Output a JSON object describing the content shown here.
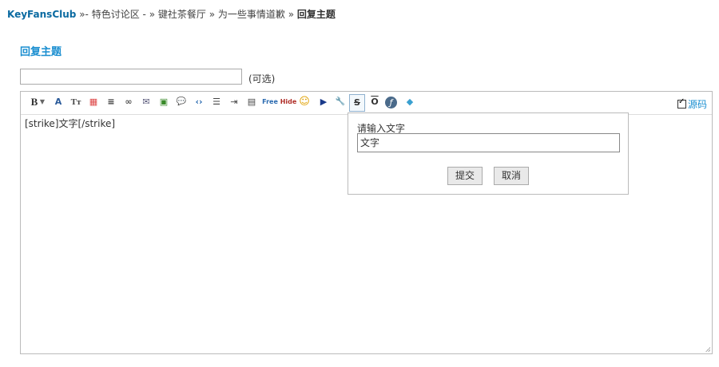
{
  "breadcrumb": {
    "site": "KeyFansClub",
    "sep1": "»-",
    "forum": "特色讨论区 -",
    "sep2": "»",
    "board": "键社茶餐厅",
    "sep3": "»",
    "thread": "为一些事情道歉",
    "sep4": "»",
    "current": "回复主题"
  },
  "page_title": "回复主题",
  "subject": {
    "value": "",
    "optional_label": "(可选)"
  },
  "toolbar": {
    "buttons": [
      {
        "name": "bold-icon",
        "glyph": "B"
      },
      {
        "name": "font-color-icon",
        "glyph": "A"
      },
      {
        "name": "font-size-icon",
        "glyph": "Tт"
      },
      {
        "name": "color-grid-icon",
        "glyph": "▦"
      },
      {
        "name": "align-icon",
        "glyph": "≡"
      },
      {
        "name": "link-icon",
        "glyph": "∞"
      },
      {
        "name": "email-icon",
        "glyph": "✉"
      },
      {
        "name": "image-icon",
        "glyph": "▣"
      },
      {
        "name": "quote-icon",
        "glyph": "💬"
      },
      {
        "name": "code-icon",
        "glyph": "‹›"
      },
      {
        "name": "ordered-list-icon",
        "glyph": "☰"
      },
      {
        "name": "indent-icon",
        "glyph": "⇥"
      },
      {
        "name": "table-icon",
        "glyph": "▤"
      },
      {
        "name": "free-icon",
        "glyph": "Free"
      },
      {
        "name": "hide-icon",
        "glyph": "Hide"
      },
      {
        "name": "smiley-icon",
        "glyph": "☺"
      },
      {
        "name": "media-icon",
        "glyph": "▶"
      },
      {
        "name": "tools-icon",
        "glyph": "🔧"
      },
      {
        "name": "strikethrough-icon",
        "glyph": "S"
      },
      {
        "name": "overline-icon",
        "glyph": "O"
      },
      {
        "name": "flash-icon",
        "glyph": "ƒ"
      },
      {
        "name": "gem-icon",
        "glyph": "◆"
      }
    ],
    "source_label": "源码"
  },
  "editor": {
    "content": "[strike]文字[/strike]"
  },
  "popup": {
    "label": "请输入文字",
    "input_value": "文字",
    "submit": "提交",
    "cancel": "取消"
  }
}
